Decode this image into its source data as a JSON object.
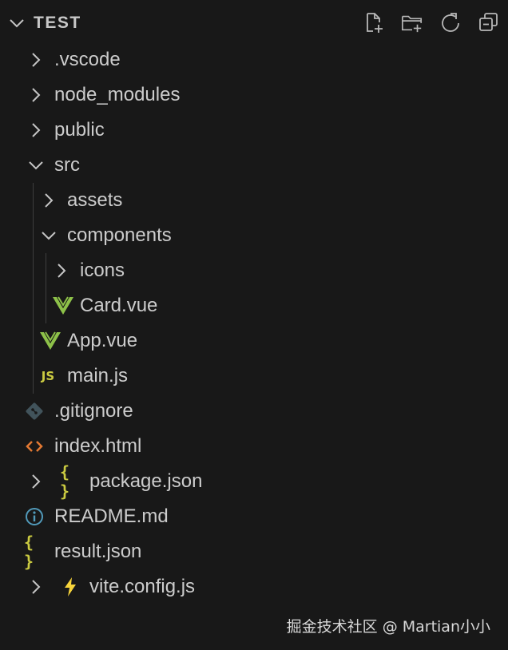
{
  "explorer": {
    "title": "TEST",
    "actions": [
      {
        "name": "new-file-icon"
      },
      {
        "name": "new-folder-icon"
      },
      {
        "name": "refresh-icon"
      },
      {
        "name": "collapse-all-icon"
      }
    ]
  },
  "tree": [
    {
      "label": ".vscode",
      "type": "folder",
      "expanded": false,
      "depth": 0
    },
    {
      "label": "node_modules",
      "type": "folder",
      "expanded": false,
      "depth": 0
    },
    {
      "label": "public",
      "type": "folder",
      "expanded": false,
      "depth": 0
    },
    {
      "label": "src",
      "type": "folder",
      "expanded": true,
      "depth": 0
    },
    {
      "label": "assets",
      "type": "folder",
      "expanded": false,
      "depth": 1
    },
    {
      "label": "components",
      "type": "folder",
      "expanded": true,
      "depth": 1
    },
    {
      "label": "icons",
      "type": "folder",
      "expanded": false,
      "depth": 2
    },
    {
      "label": "Card.vue",
      "type": "file",
      "icon": "vue-icon",
      "depth": 2
    },
    {
      "label": "App.vue",
      "type": "file",
      "icon": "vue-icon",
      "depth": 1
    },
    {
      "label": "main.js",
      "type": "file",
      "icon": "javascript-icon",
      "icon_text": "JS",
      "depth": 1
    },
    {
      "label": ".gitignore",
      "type": "file",
      "icon": "git-icon",
      "depth": 0
    },
    {
      "label": "index.html",
      "type": "file",
      "icon": "html-icon",
      "depth": 0
    },
    {
      "label": "package.json",
      "type": "nested",
      "expanded": false,
      "icon": "json-icon",
      "icon_text": "{ }",
      "depth": 0
    },
    {
      "label": "README.md",
      "type": "file",
      "icon": "info-icon",
      "depth": 0
    },
    {
      "label": "result.json",
      "type": "file",
      "icon": "json-icon",
      "icon_text": "{ }",
      "depth": 0
    },
    {
      "label": "vite.config.js",
      "type": "nested",
      "expanded": false,
      "icon": "vite-icon",
      "depth": 0
    }
  ],
  "colors": {
    "background": "#181818",
    "text": "#cccccc",
    "vue": "#8dc149",
    "json": "#cbcb41",
    "html": "#e37933",
    "info": "#519aba",
    "git": "#41535b",
    "vite": "#f7d43b"
  },
  "watermark": "掘金技术社区 @ Martian小小"
}
